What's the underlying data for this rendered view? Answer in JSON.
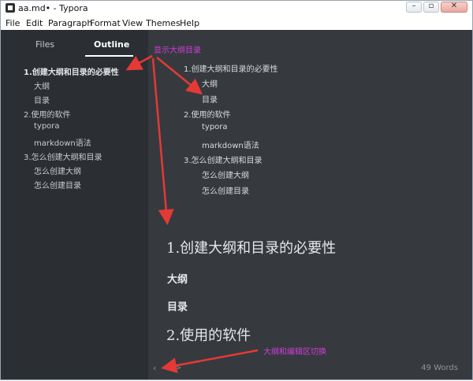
{
  "window": {
    "title": "aa.md• - Typora"
  },
  "menu": [
    "File",
    "Edit",
    "Paragraph",
    "Format",
    "View",
    "Themes",
    "Help"
  ],
  "sidebar": {
    "tabs": [
      "Files",
      "Outline"
    ],
    "active_tab": "Outline",
    "outline": [
      {
        "label": "1.创建大纲和目录的必要性",
        "level": 1
      },
      {
        "label": "大纲",
        "level": 2
      },
      {
        "label": "目录",
        "level": 2
      },
      {
        "label": "2.使用的软件",
        "level": 1
      },
      {
        "label": "typora",
        "level": 2
      },
      {
        "label": "markdown语法",
        "level": 2
      },
      {
        "label": "3.怎么创建大纲和目录",
        "level": 1
      },
      {
        "label": "怎么创建大纲",
        "level": 2
      },
      {
        "label": "怎么创建目录",
        "level": 2
      }
    ]
  },
  "editor": {
    "toc": [
      "1.创建大纲和目录的必要性",
      "大纲",
      "目录",
      "2.使用的软件",
      "typora",
      "markdown语法",
      "3.怎么创建大纲和目录",
      "怎么创建大纲",
      "怎么创建目录"
    ],
    "headings": {
      "h1_first": "1.创建大纲和目录的必要性",
      "h2_a": "大纲",
      "h2_b": "目录",
      "h1_second": "2.使用的软件"
    },
    "word_count": "49 Words"
  },
  "annotations": {
    "show_outline": "显示大纲目录",
    "toggle": "大纲和编辑区切换"
  },
  "footer": {
    "collapse_symbol": "‹",
    "source_symbol": "</>"
  },
  "colors": {
    "sidebar_bg": "#2b2f33",
    "editor_bg": "#363a3f",
    "annotation": "#d23ad8",
    "arrow": "#e53935"
  }
}
